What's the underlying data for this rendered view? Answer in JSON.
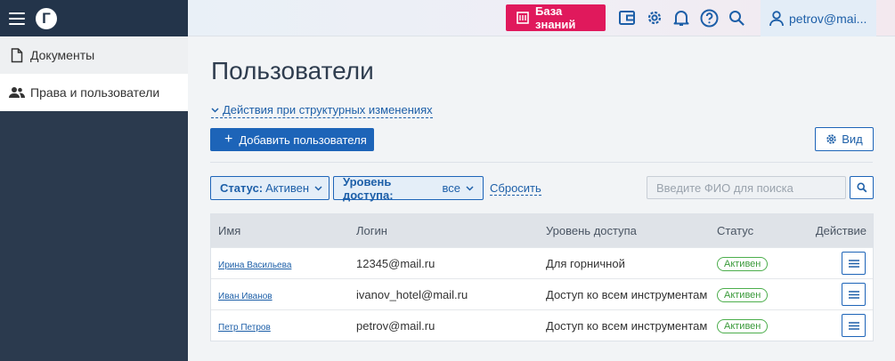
{
  "sidebar": {
    "logo_letter": "Г",
    "items": [
      {
        "label": "Документы",
        "icon": "document-icon"
      },
      {
        "label": "Права и пользователи",
        "icon": "users-icon"
      }
    ]
  },
  "header": {
    "knowledge_base_label": "База знаний",
    "user_label": "petrov@mai...",
    "icons": [
      "wallet-icon",
      "gear-icon",
      "bell-icon",
      "help-icon",
      "search-icon",
      "user-icon"
    ],
    "accent_color": "#e0195c"
  },
  "main": {
    "title": "Пользователи",
    "structural_link": "Действия при структурных изменениях",
    "add_button": "Добавить пользователя",
    "view_button": "Вид",
    "filters": {
      "status_label": "Статус:",
      "status_value": "Активен",
      "access_label": "Уровень доступа:",
      "access_value": "все",
      "reset": "Сбросить"
    },
    "search": {
      "placeholder": "Введите ФИО для поиска",
      "value": ""
    },
    "table": {
      "columns": [
        "Имя",
        "Логин",
        "Уровень доступа",
        "Статус",
        "Действие"
      ],
      "rows": [
        {
          "name": "Ирина Васильева",
          "login": "12345@mail.ru",
          "access": "Для горничной",
          "status": "Активен"
        },
        {
          "name": "Иван Иванов",
          "login": "ivanov_hotel@mail.ru",
          "access": "Доступ ко всем инструментам",
          "status": "Активен"
        },
        {
          "name": "Петр Петров",
          "login": "petrov@mail.ru",
          "access": "Доступ ко всем инструментам",
          "status": "Активен"
        }
      ]
    }
  },
  "colors": {
    "primary": "#1d64b8",
    "sidebar": "#2b3a4e",
    "status_active": "#4cae4c"
  }
}
